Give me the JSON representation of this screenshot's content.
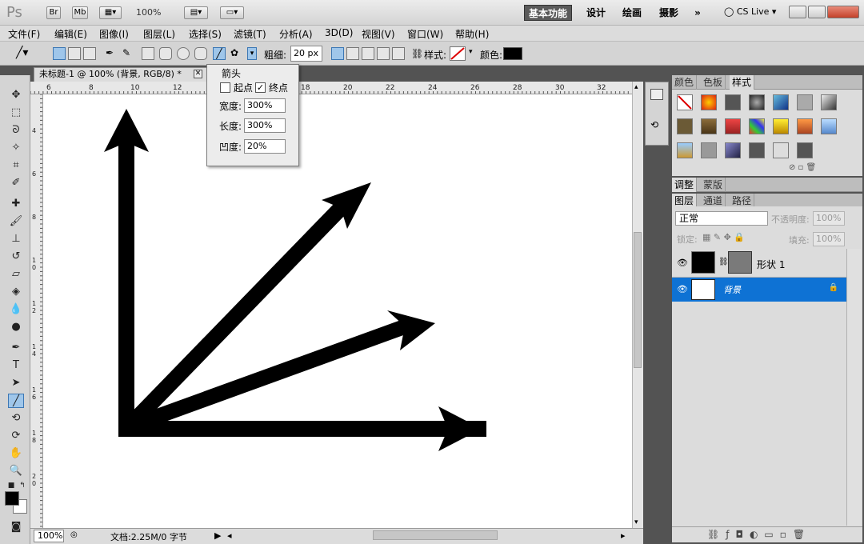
{
  "app": {
    "logo": "Ps",
    "bridge_btn": "Br",
    "minibridge_btn": "Mb",
    "zoom": "100%",
    "workspaces": [
      "基本功能",
      "设计",
      "绘画",
      "摄影"
    ],
    "cslive": "CS Live",
    "more": "»"
  },
  "menu": [
    "文件(F)",
    "编辑(E)",
    "图像(I)",
    "图层(L)",
    "选择(S)",
    "滤镜(T)",
    "分析(A)",
    "3D(D)",
    "视图(V)",
    "窗口(W)",
    "帮助(H)"
  ],
  "options": {
    "weight_label": "粗细:",
    "weight_value": "20 px",
    "style_label": "样式:",
    "color_label": "颜色:"
  },
  "document": {
    "tab_title": "未标题-1 @ 100% (背景, RGB/8) *",
    "zoom": "100%",
    "info": "文档:2.25M/0 字节",
    "ruler_h": [
      "6",
      "8",
      "10",
      "12",
      "18",
      "20",
      "22",
      "24",
      "26",
      "28",
      "30",
      "32"
    ],
    "ruler_v": [
      "4",
      "6",
      "8",
      "1 0",
      "1 2",
      "1 4",
      "1 6",
      "1 8",
      "2 0"
    ]
  },
  "arrow_popup": {
    "title": "箭头",
    "start": "起点",
    "end": "终点",
    "start_checked": false,
    "end_checked": true,
    "width_label": "宽度:",
    "width_value": "300%",
    "length_label": "长度:",
    "length_value": "300%",
    "concavity_label": "凹度:",
    "concavity_value": "20%"
  },
  "panels": {
    "top_tabs": [
      "颜色",
      "色板",
      "样式"
    ],
    "adjust_tabs": [
      "调整",
      "蒙版"
    ],
    "layer_tabs": [
      "图层",
      "通道",
      "路径"
    ],
    "blend_mode": "正常",
    "opacity_label": "不透明度:",
    "opacity_value": "100%",
    "lock_label": "锁定:",
    "fill_label": "填充:",
    "fill_value": "100%",
    "layers": [
      {
        "name": "形状 1",
        "selected": false
      },
      {
        "name": "背景",
        "selected": true
      }
    ]
  },
  "colors": {
    "workspace_bg": "#535353",
    "selection": "#0e72d4",
    "foreground": "#000000",
    "background": "#ffffff"
  }
}
